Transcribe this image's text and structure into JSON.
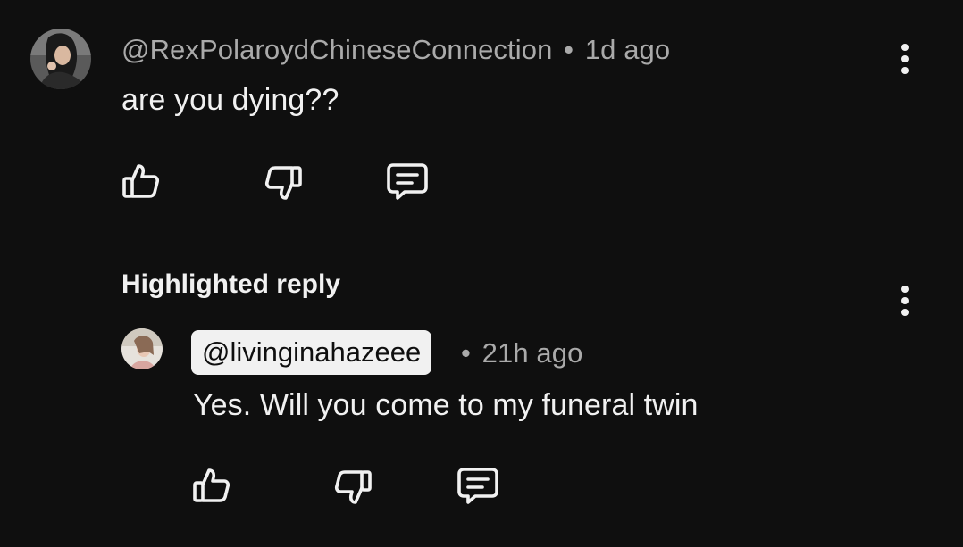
{
  "comment": {
    "author": "@RexPolaroydChineseConnection",
    "separator": "•",
    "time": "1d ago",
    "text": "are you dying??",
    "actions": {
      "like_icon": "thumbs-up-icon",
      "dislike_icon": "thumbs-down-icon",
      "reply_icon": "reply-comment-icon"
    }
  },
  "highlighted_section": {
    "label": "Highlighted reply"
  },
  "reply": {
    "author": "@livinginahazeee",
    "separator": "•",
    "time": "21h ago",
    "text": "Yes. Will you come to my funeral twin",
    "actions": {
      "like_icon": "thumbs-up-icon",
      "dislike_icon": "thumbs-down-icon",
      "reply_icon": "reply-comment-icon"
    }
  },
  "colors": {
    "background": "#0f0f0f",
    "primary_text": "#f1f1f1",
    "secondary_text": "#aaaaaa",
    "chip_background": "#f1f1f1"
  }
}
